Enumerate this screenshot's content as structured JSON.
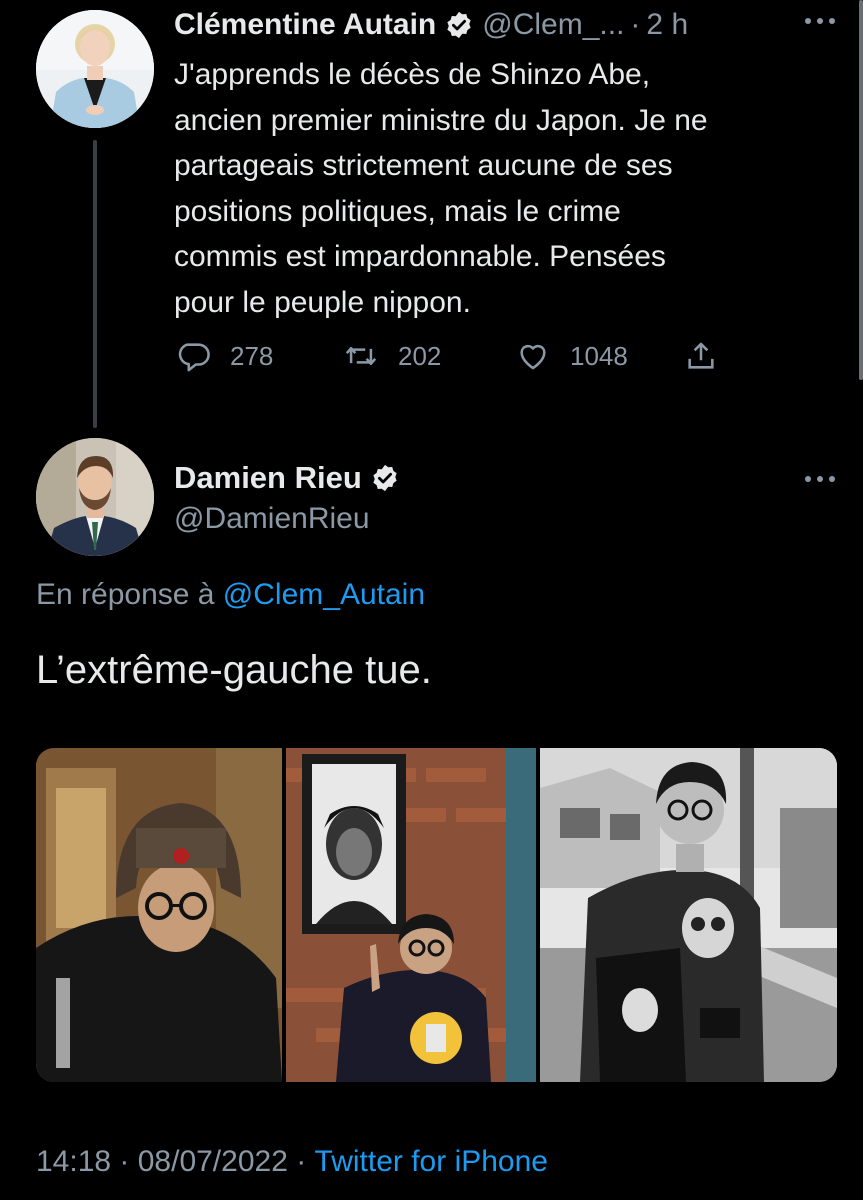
{
  "tweet1": {
    "display_name": "Clémentine Autain",
    "handle": "@Clem_...",
    "separator": "·",
    "time": "2 h",
    "text": "J'apprends le décès de Shinzo Abe,\nancien premier ministre du Japon. Je ne\npartageais strictement aucune de ses\npositions politiques, mais le crime\ncommis est impardonnable. Pensées\npour le peuple nippon.",
    "replies": "278",
    "retweets": "202",
    "likes": "1048"
  },
  "tweet2": {
    "display_name": "Damien Rieu",
    "handle": "@DamienRieu",
    "reply_prefix": "En réponse à ",
    "reply_mention": "@Clem_Autain",
    "text": "L’extrême-gauche tue.",
    "timestamp": "14:18 · 08/07/2022 · ",
    "source": "Twitter for iPhone"
  },
  "icons": {
    "verified": "verified-badge-icon",
    "more": "more-horizontal-icon",
    "reply": "reply-bubble-icon",
    "retweet": "retweet-icon",
    "like": "heart-icon",
    "share": "share-icon"
  },
  "colors": {
    "background": "#000000",
    "text_primary": "#e7e9ea",
    "text_secondary": "#8b98a5",
    "link": "#1d9bf0"
  }
}
